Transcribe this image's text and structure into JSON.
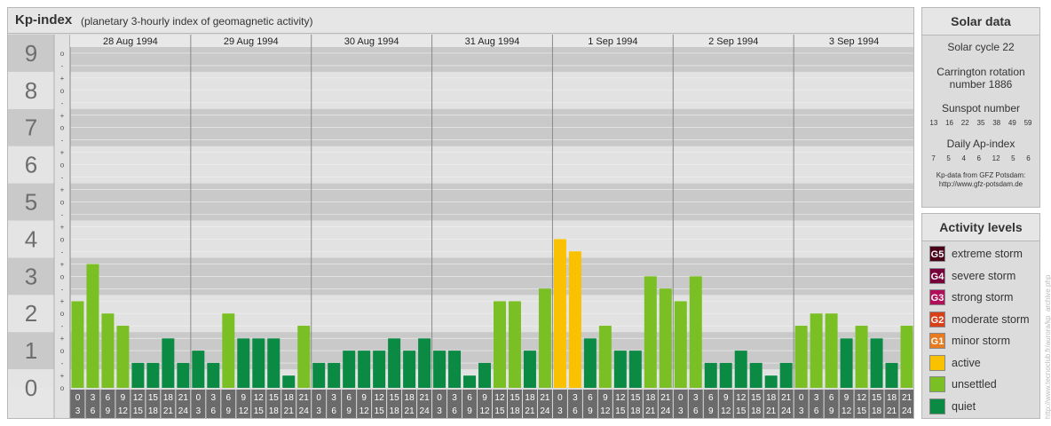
{
  "header": {
    "title": "Kp-index",
    "subtitle": "(planetary 3-hourly index of geomagnetic activity)"
  },
  "chart_data": {
    "type": "bar",
    "y_major_labels": [
      "0",
      "1",
      "2",
      "3",
      "4",
      "5",
      "6",
      "7",
      "8",
      "9"
    ],
    "y_minor_labels": [
      "-",
      "o",
      "+"
    ],
    "ylim": [
      0,
      9.33
    ],
    "days": [
      {
        "label": "28 Aug 1994",
        "values": [
          2.33,
          3.33,
          2.0,
          1.67,
          0.67,
          0.67,
          1.33,
          0.67
        ]
      },
      {
        "label": "29 Aug 1994",
        "values": [
          1.0,
          0.67,
          2.0,
          1.33,
          1.33,
          1.33,
          0.33,
          1.67
        ]
      },
      {
        "label": "30 Aug 1994",
        "values": [
          0.67,
          0.67,
          1.0,
          1.0,
          1.0,
          1.33,
          1.0,
          1.33
        ]
      },
      {
        "label": "31 Aug 1994",
        "values": [
          1.0,
          1.0,
          0.33,
          0.67,
          2.33,
          2.33,
          1.0,
          2.67
        ]
      },
      {
        "label": "1 Sep 1994",
        "values": [
          4.0,
          3.67,
          1.33,
          1.67,
          1.0,
          1.0,
          3.0,
          2.67
        ]
      },
      {
        "label": "2 Sep 1994",
        "values": [
          2.33,
          3.0,
          0.67,
          0.67,
          1.0,
          0.67,
          0.33,
          0.67
        ]
      },
      {
        "label": "3 Sep 1994",
        "values": [
          1.67,
          2.0,
          2.0,
          1.33,
          1.67,
          1.33,
          0.67,
          1.67
        ]
      }
    ],
    "interval_start_labels": [
      "0",
      "3",
      "6",
      "9",
      "12",
      "15",
      "18",
      "21"
    ],
    "interval_end_labels": [
      "3",
      "6",
      "9",
      "12",
      "15",
      "18",
      "21",
      "24"
    ],
    "level_colors": {
      "quiet": "#0a8a43",
      "unsettled": "#7abf24",
      "active": "#f9c100"
    }
  },
  "solar": {
    "title": "Solar data",
    "cycle": "Solar cycle 22",
    "carrington_line1": "Carrington rotation",
    "carrington_line2": "number 1886",
    "sunspot_label": "Sunspot number",
    "sunspot_values": [
      "13",
      "16",
      "22",
      "35",
      "38",
      "49",
      "59"
    ],
    "ap_label": "Daily Ap-index",
    "ap_values": [
      "7",
      "5",
      "4",
      "6",
      "12",
      "5",
      "6"
    ],
    "source_line1": "Kp-data from GFZ Potsdam:",
    "source_line2": "http://www.gfz-potsdam.de"
  },
  "activity": {
    "title": "Activity levels",
    "items": [
      {
        "code": "G5",
        "label": "extreme storm",
        "color": "#4a0018"
      },
      {
        "code": "G4",
        "label": "severe storm",
        "color": "#78003a"
      },
      {
        "code": "G3",
        "label": "strong storm",
        "color": "#b0105a"
      },
      {
        "code": "G2",
        "label": "moderate storm",
        "color": "#d8401a"
      },
      {
        "code": "G1",
        "label": "minor storm",
        "color": "#e87a20"
      },
      {
        "code": "",
        "label": "active",
        "color": "#f9c100"
      },
      {
        "code": "",
        "label": "unsettled",
        "color": "#7abf24"
      },
      {
        "code": "",
        "label": "quiet",
        "color": "#0a8a43"
      }
    ]
  },
  "credit": "http://www.tecnoclub.fr/aurora/kp_archive.php"
}
